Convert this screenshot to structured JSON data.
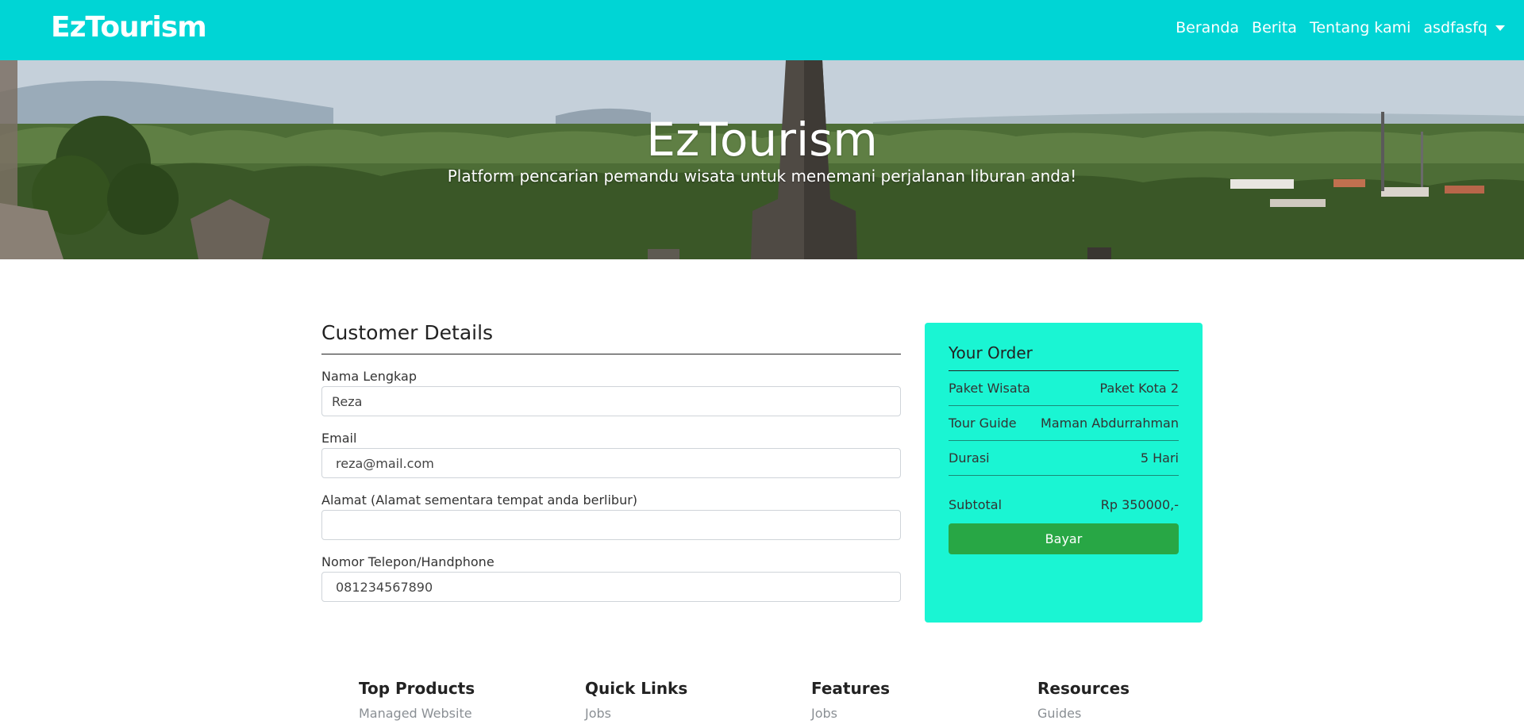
{
  "navbar": {
    "brand": "EzTourism",
    "links": [
      "Beranda",
      "Berita",
      "Tentang kami"
    ],
    "user_menu": "asdfasfq",
    "bg_color": "#00d5d5"
  },
  "hero": {
    "title": "EzTourism",
    "subtitle": "Platform pencarian pemandu wisata untuk menemani perjalanan liburan anda!"
  },
  "customer": {
    "title": "Customer Details",
    "fields": [
      {
        "label": "Nama Lengkap",
        "value": "Reza"
      },
      {
        "label": "Email",
        "value": "reza@mail.com"
      },
      {
        "label": "Alamat (Alamat sementara tempat anda berlibur)",
        "value": ""
      },
      {
        "label": "Nomor Telepon/Handphone",
        "value": "081234567890"
      }
    ]
  },
  "order": {
    "title": "Your Order",
    "rows": [
      {
        "label": "Paket Wisata",
        "value": "Paket Kota 2"
      },
      {
        "label": "Tour Guide",
        "value": "Maman Abdurrahman"
      },
      {
        "label": "Durasi",
        "value": "5 Hari"
      }
    ],
    "subtotal_label": "Subtotal",
    "subtotal_value": "Rp 350000,-",
    "pay_label": "Bayar",
    "card_color": "#1af5d3",
    "pay_color": "#28a745"
  },
  "footer": {
    "columns": [
      {
        "title": "Top Products",
        "link": "Managed Website"
      },
      {
        "title": "Quick Links",
        "link": "Jobs"
      },
      {
        "title": "Features",
        "link": "Jobs"
      },
      {
        "title": "Resources",
        "link": "Guides"
      }
    ]
  }
}
